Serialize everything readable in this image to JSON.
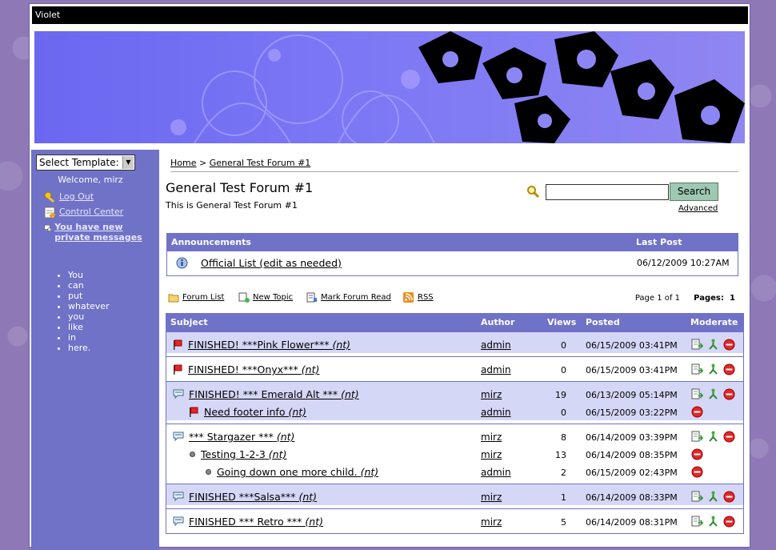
{
  "window": {
    "title": "Violet"
  },
  "sidebar": {
    "template_select": "Select Template:",
    "welcome": "Welcome, mirz",
    "logout": "Log Out",
    "control_center": "Control Center",
    "private_messages": "You have new private messages",
    "list_items": [
      "You",
      "can",
      "put",
      "whatever",
      "you",
      "like",
      "in",
      "here."
    ]
  },
  "breadcrumb": {
    "home": "Home",
    "separator": ">",
    "current": "General Test Forum #1"
  },
  "forum": {
    "title": "General Test Forum #1",
    "description": "This is General Test Forum #1"
  },
  "search": {
    "button": "Search",
    "advanced": "Advanced"
  },
  "announcements": {
    "header_label": "Announcements",
    "header_last_post": "Last Post",
    "item_title": "Official List (edit as needed)",
    "item_date": "06/12/2009 10:27AM"
  },
  "toolbar": {
    "forum_list": "Forum List",
    "new_topic": "New Topic",
    "mark_read": "Mark Forum Read",
    "rss": "RSS",
    "page_info": "Page 1 of 1",
    "pages_label": "Pages:",
    "pages_current": "1"
  },
  "topics_header": {
    "subject": "Subject",
    "author": "Author",
    "views": "Views",
    "posted": "Posted",
    "moderate": "Moderate"
  },
  "topics": [
    {
      "rows": [
        {
          "title": "FINISHED! ***Pink Flower***",
          "nt": "(nt)",
          "author": "admin",
          "views": "0",
          "posted": "06/15/2009 03:41PM",
          "icon": "red-flag-icon",
          "indent": 0,
          "mod": "full"
        }
      ]
    },
    {
      "rows": [
        {
          "title": "FINISHED! ***Onyx***",
          "nt": "(nt)",
          "author": "admin",
          "views": "0",
          "posted": "06/15/2009 03:41PM",
          "icon": "red-flag-icon",
          "indent": 0,
          "mod": "full"
        }
      ]
    },
    {
      "rows": [
        {
          "title": "FINISHED! *** Emerald Alt ***",
          "nt": "(nt)",
          "author": "mirz",
          "views": "19",
          "posted": "06/13/2009 05:14PM",
          "icon": "speech-bubble-icon",
          "indent": 0,
          "mod": "full"
        },
        {
          "title": "Need footer info",
          "nt": "(nt)",
          "author": "admin",
          "views": "0",
          "posted": "06/15/2009 03:22PM",
          "icon": "red-flag-icon",
          "indent": 1,
          "mod": "delete"
        }
      ]
    },
    {
      "rows": [
        {
          "title": "*** Stargazer ***",
          "nt": "(nt)",
          "author": "mirz",
          "views": "8",
          "posted": "06/14/2009 03:39PM",
          "icon": "speech-bubble-icon",
          "indent": 0,
          "mod": "full"
        },
        {
          "title": "Testing 1-2-3",
          "nt": "(nt)",
          "author": "mirz",
          "views": "13",
          "posted": "06/14/2009 08:35PM",
          "icon": "bullet-icon",
          "indent": 1,
          "mod": "delete"
        },
        {
          "title": "Going down one more child.",
          "nt": "(nt)",
          "author": "admin",
          "views": "2",
          "posted": "06/15/2009 02:43PM",
          "icon": "bullet-icon",
          "indent": 2,
          "mod": "delete"
        }
      ]
    },
    {
      "rows": [
        {
          "title": "FINISHED ***Salsa***",
          "nt": "(nt)",
          "author": "mirz",
          "views": "1",
          "posted": "06/14/2009 08:33PM",
          "icon": "speech-bubble-icon",
          "indent": 0,
          "mod": "full"
        }
      ]
    },
    {
      "rows": [
        {
          "title": "FINISHED *** Retro ***",
          "nt": "(nt)",
          "author": "mirz",
          "views": "5",
          "posted": "06/14/2009 08:31PM",
          "icon": "speech-bubble-icon",
          "indent": 0,
          "mod": "full"
        }
      ]
    }
  ]
}
